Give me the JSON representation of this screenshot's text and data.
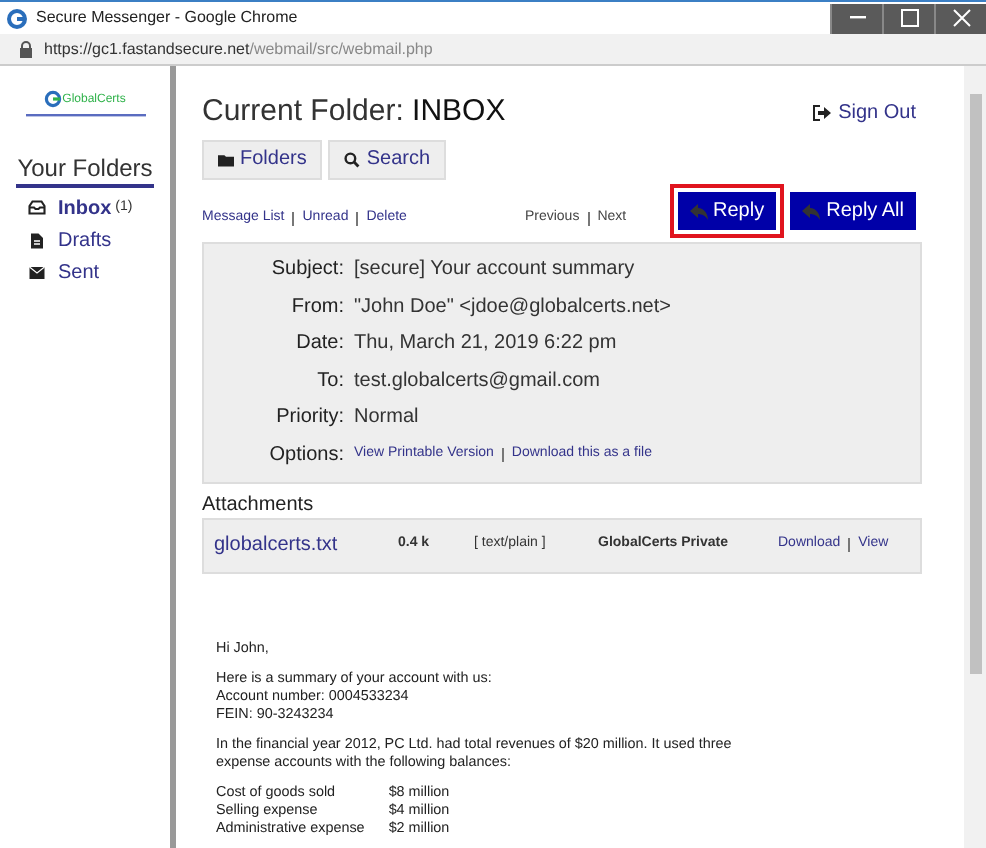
{
  "window": {
    "title": "Secure Messenger - Google Chrome",
    "url_host": "https://gc1.fastandsecure.net",
    "url_path": "/webmail/src/webmail.php"
  },
  "sidebar": {
    "logo": "GlobalCerts",
    "heading": "Your Folders",
    "folders": [
      {
        "label": "Inbox",
        "count": "(1)",
        "selected": true,
        "kind": "inbox"
      },
      {
        "label": "Drafts",
        "selected": false,
        "kind": "drafts"
      },
      {
        "label": "Sent",
        "selected": false,
        "kind": "sent"
      }
    ]
  },
  "header": {
    "title_prefix": "Current Folder:",
    "folder": "INBOX",
    "sign_out": "Sign Out",
    "buttons": [
      {
        "label": "Folders",
        "kind": "folder"
      },
      {
        "label": "Search",
        "kind": "search"
      }
    ]
  },
  "nav_links": [
    "Message List",
    "Unread",
    "Delete"
  ],
  "pager_links": [
    "Previous",
    "Next"
  ],
  "actions": [
    {
      "label": "Reply",
      "highlighted": true
    },
    {
      "label": "Reply All",
      "highlighted": false
    }
  ],
  "message": {
    "fields": [
      {
        "label": "Subject:",
        "value": "[secure] Your account summary"
      },
      {
        "label": "From:",
        "value": "\"John Doe\" <jdoe@globalcerts.net>"
      },
      {
        "label": "Date:",
        "value": "Thu, March 21, 2019 6:22 pm"
      },
      {
        "label": "To:",
        "value": "test.globalcerts@gmail.com"
      },
      {
        "label": "Priority:",
        "value": "Normal"
      }
    ],
    "options_label": "Options:",
    "options": [
      "View Printable Version",
      "Download this as a file"
    ]
  },
  "attachments": {
    "heading": "Attachments",
    "items": [
      {
        "name": "globalcerts.txt",
        "size": "0.4 k",
        "type": "[ text/plain ]",
        "label": "GlobalCerts Private",
        "links": [
          "Download",
          "View"
        ]
      }
    ]
  },
  "body": {
    "paragraphs": [
      [
        "Hi John,"
      ],
      [
        "Here is a summary of your account with us:",
        "Account number: 0004533234",
        "FEIN: 90-3243234"
      ],
      [
        "In the financial year 2012, PC Ltd. had total revenues of $20 million. It used three",
        "expense accounts with the following balances:"
      ]
    ],
    "balances": [
      {
        "label": "Cost of goods sold",
        "amount": "$8 million"
      },
      {
        "label": "Selling expense",
        "amount": "$4 million"
      },
      {
        "label": "Administrative expense",
        "amount": "$2 million"
      }
    ]
  }
}
